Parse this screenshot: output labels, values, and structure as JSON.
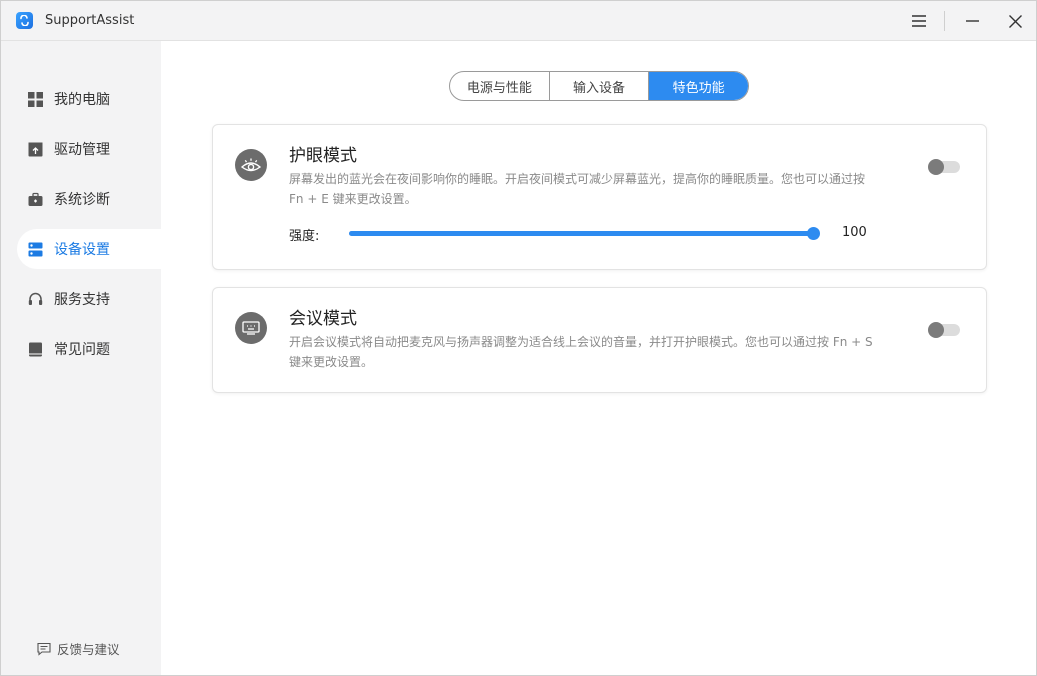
{
  "app": {
    "title": "SupportAssist"
  },
  "sidebar": {
    "items": [
      {
        "label": "我的电脑",
        "icon": "grid-icon"
      },
      {
        "label": "驱动管理",
        "icon": "driver-box-icon"
      },
      {
        "label": "系统诊断",
        "icon": "toolbox-icon"
      },
      {
        "label": "设备设置",
        "icon": "settings-list-icon",
        "active": true
      },
      {
        "label": "服务支持",
        "icon": "headset-icon"
      },
      {
        "label": "常见问题",
        "icon": "book-icon"
      }
    ],
    "feedback_label": "反馈与建议"
  },
  "tabs": [
    {
      "label": "电源与性能"
    },
    {
      "label": "输入设备"
    },
    {
      "label": "特色功能",
      "active": true
    }
  ],
  "eye_care": {
    "title": "护眼模式",
    "description": "屏幕发出的蓝光会在夜间影响你的睡眠。开启夜间模式可减少屏幕蓝光，提高你的睡眠质量。您也可以通过按 Fn + E 键来更改设置。",
    "enabled": false,
    "strength_label": "强度:",
    "strength_value": "100",
    "strength_fraction": 1.0
  },
  "meeting": {
    "title": "会议模式",
    "description": "开启会议模式将自动把麦克风与扬声器调整为适合线上会议的音量，并打开护眼模式。您也可以通过按 Fn + S 键来更改设置。",
    "enabled": false
  },
  "colors": {
    "accent": "#2d8bf0",
    "active_nav_text": "#1c7be3",
    "sidebar_bg": "#f3f3f4"
  }
}
